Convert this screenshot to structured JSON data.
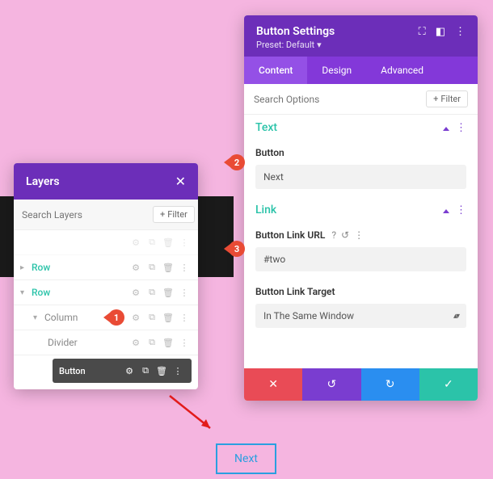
{
  "layers": {
    "title": "Layers",
    "search_placeholder": "Search Layers",
    "filter_label": "Filter",
    "rows": [
      {
        "label": "Row"
      },
      {
        "label": "Row"
      },
      {
        "label": "Column"
      },
      {
        "label": "Divider"
      },
      {
        "label": "Button"
      }
    ]
  },
  "settings": {
    "title": "Button Settings",
    "preset_label": "Preset: Default",
    "tabs": {
      "content": "Content",
      "design": "Design",
      "advanced": "Advanced"
    },
    "search_placeholder": "Search Options",
    "filter_label": "Filter",
    "sections": {
      "text": {
        "title": "Text",
        "button_label": "Button",
        "button_value": "Next"
      },
      "link": {
        "title": "Link",
        "url_label": "Button Link URL",
        "url_help": "?",
        "url_value": "#two",
        "target_label": "Button Link Target",
        "target_value": "In The Same Window"
      }
    }
  },
  "badges": {
    "b1": "1",
    "b2": "2",
    "b3": "3"
  },
  "preview_button": "Next"
}
